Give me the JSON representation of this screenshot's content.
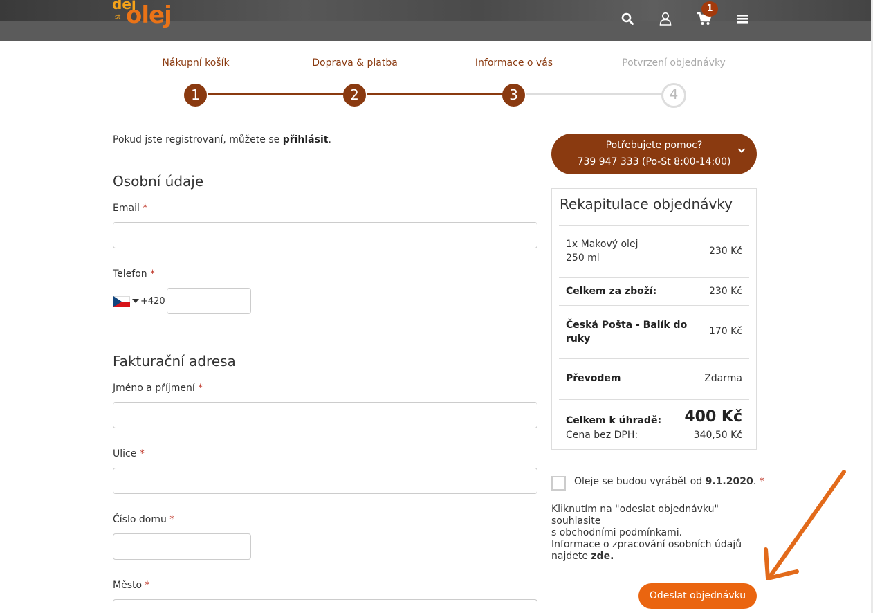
{
  "header": {
    "logo": {
      "small": "dej",
      "big": "olej",
      "mid": "st"
    },
    "cart_count": "1",
    "icons": [
      "search-icon",
      "user-icon",
      "cart-icon",
      "menu-icon"
    ]
  },
  "steps": [
    {
      "label": "Nákupní košík",
      "number": "1",
      "state": "done"
    },
    {
      "label": "Doprava & platba",
      "number": "2",
      "state": "done"
    },
    {
      "label": "Informace o vás",
      "number": "3",
      "state": "active"
    },
    {
      "label": "Potvrzení objednávky",
      "number": "4",
      "state": "inactive"
    }
  ],
  "intro": {
    "text": "Pokud jste registrovaní, můžete se ",
    "link": "přihlásit",
    "end": "."
  },
  "personal": {
    "title": "Osobní údaje",
    "email_label": "Email",
    "phone_label": "Telefon",
    "dial_code": "+420",
    "required_mark": "*"
  },
  "billing": {
    "title": "Fakturační adresa",
    "name_label": "Jméno a příjmení",
    "street_label": "Ulice",
    "house_label": "Číslo domu",
    "city_label": "Město"
  },
  "help": {
    "line1": "Potřebujete pomoc?",
    "line2": "739 947 333 (Po-St 8:00-14:00)"
  },
  "summary": {
    "title": "Rekapitulace objednávky",
    "item_line1": "1x Makový olej",
    "item_line2": "250 ml",
    "item_price": "230 Kč",
    "goods_label": "Celkem za zboží:",
    "goods_price": "230 Kč",
    "shipping_line1": "Česká Pošta - Balík do",
    "shipping_line2": "ruky",
    "shipping_price": "170 Kč",
    "payment_label": "Převodem",
    "payment_price": "Zdarma",
    "total_label": "Celkem k úhradě:",
    "total_value": "400 Kč",
    "net_label": "Cena bez DPH:",
    "net_value": "340,50 Kč"
  },
  "consent": {
    "text": "Oleje se budou vyrábět od ",
    "date": "9.1.2020",
    "end": ".",
    "required_mark": "*"
  },
  "terms": {
    "line1": "Kliknutím na \"odeslat objednávku\" souhlasite",
    "line2": "s obchodními podmínkami."
  },
  "privacy": {
    "line1": "Informace o zpracování osobních údajů",
    "line2": "najdete ",
    "link": "zde."
  },
  "submit_label": "Odeslat objednávku",
  "colors": {
    "brand": "#8a3a10",
    "accent": "#ea6510"
  }
}
